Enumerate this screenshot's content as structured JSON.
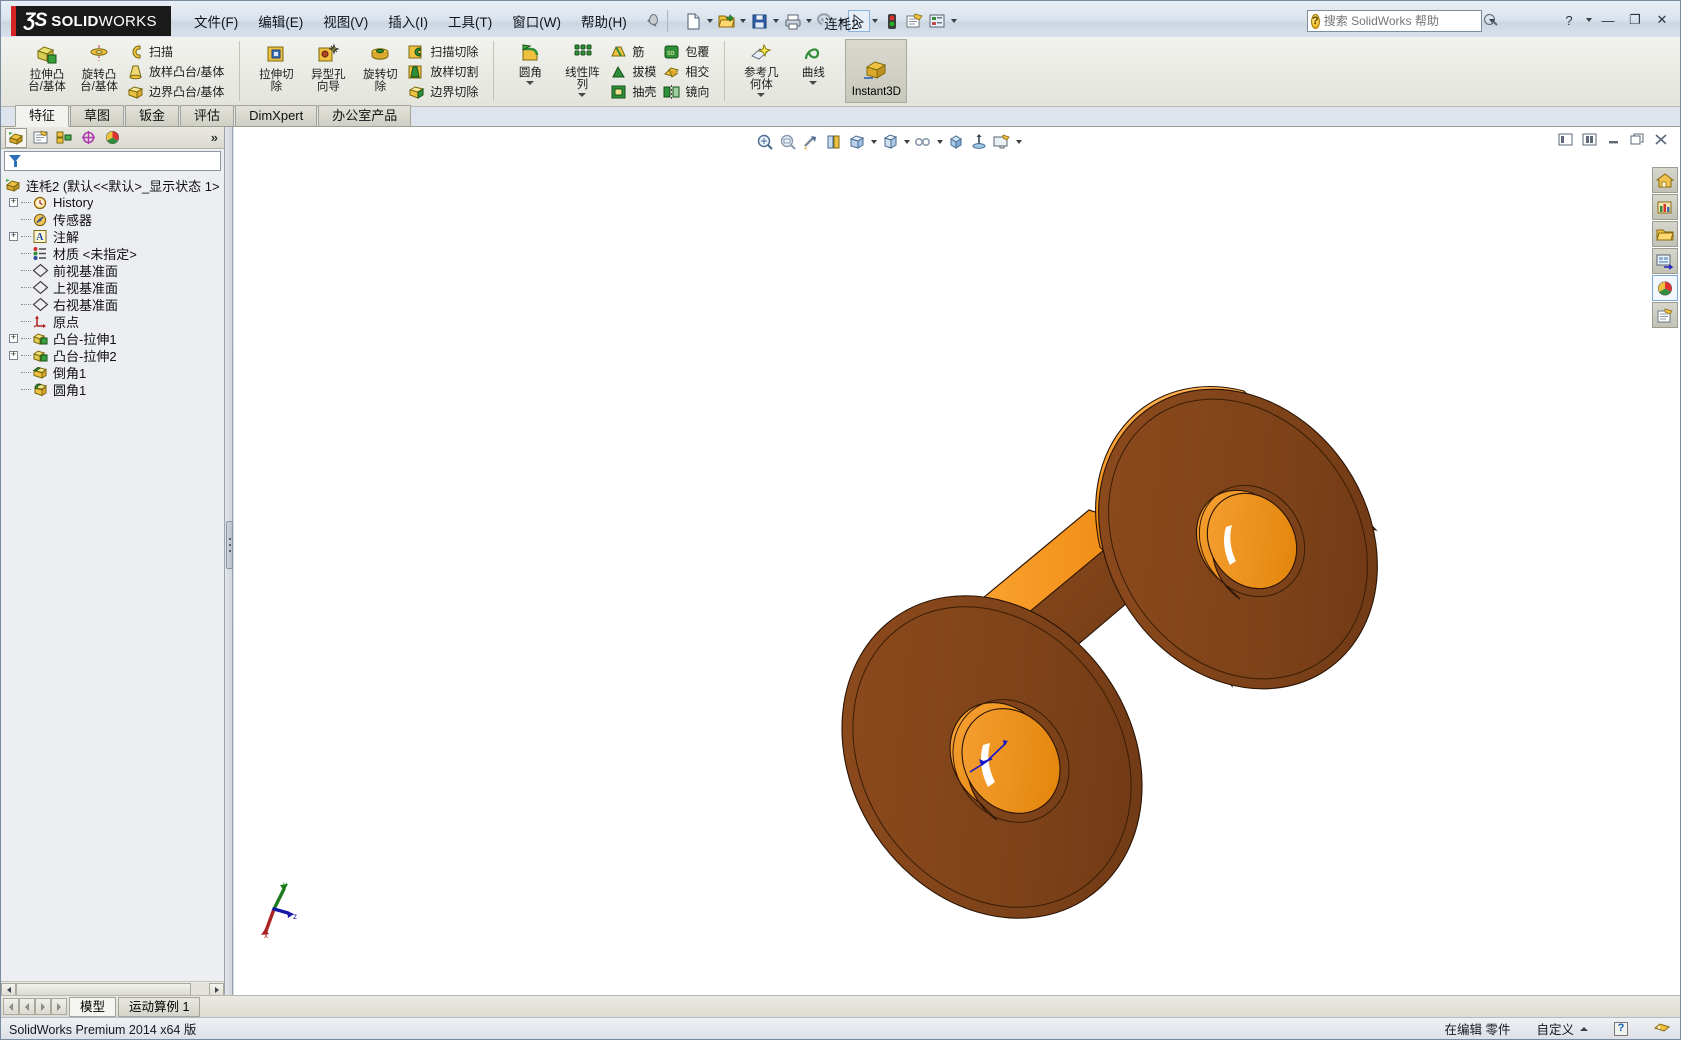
{
  "app": {
    "brand_ds": "ƷS",
    "brand_name_bold": "SOLID",
    "brand_name_thin": "WORKS",
    "document_title": "连枆2",
    "accent_red": "#d42424",
    "model_orange": "#f39019",
    "model_brown": "#8a4a1e"
  },
  "menubar": {
    "items": [
      {
        "label": "文件(F)",
        "name": "menu-file"
      },
      {
        "label": "编辑(E)",
        "name": "menu-edit"
      },
      {
        "label": "视图(V)",
        "name": "menu-view"
      },
      {
        "label": "插入(I)",
        "name": "menu-insert"
      },
      {
        "label": "工具(T)",
        "name": "menu-tools"
      },
      {
        "label": "窗口(W)",
        "name": "menu-window"
      },
      {
        "label": "帮助(H)",
        "name": "menu-help"
      }
    ]
  },
  "quick_toolbar": {
    "buttons": [
      {
        "name": "new-document-icon",
        "glyph": "new"
      },
      {
        "name": "open-document-icon",
        "glyph": "open"
      },
      {
        "name": "save-icon",
        "glyph": "save"
      },
      {
        "name": "print-icon",
        "glyph": "print"
      },
      {
        "name": "undo-icon",
        "glyph": "undo"
      },
      {
        "name": "select-arrow-icon",
        "glyph": "select"
      },
      {
        "name": "rebuild-traffic-light-icon",
        "glyph": "rebuild"
      },
      {
        "name": "options-icon",
        "glyph": "options"
      },
      {
        "name": "properties-icon",
        "glyph": "props"
      }
    ]
  },
  "search": {
    "placeholder": "搜索 SolidWorks 帮助",
    "value": ""
  },
  "window_buttons": {
    "help": "?",
    "minimize": "—",
    "restore": "❐",
    "close": "✕"
  },
  "ribbon": {
    "groups": [
      {
        "name": "features-boss",
        "big": [
          {
            "label": "拉伸凸\n台/基体",
            "name": "extruded-boss-base-button",
            "icon": "extrude-boss-icon"
          },
          {
            "label": "旋转凸\n台/基体",
            "name": "revolved-boss-base-button",
            "icon": "revolve-boss-icon"
          }
        ],
        "small": [
          {
            "label": "扫描",
            "name": "swept-boss-button",
            "icon": "sweep-icon"
          },
          {
            "label": "放样凸台/基体",
            "name": "lofted-boss-button",
            "icon": "loft-icon"
          },
          {
            "label": "边界凸台/基体",
            "name": "boundary-boss-button",
            "icon": "boundary-icon"
          }
        ]
      },
      {
        "name": "features-cut",
        "big": [
          {
            "label": "拉伸切\n除",
            "name": "extruded-cut-button",
            "icon": "extrude-cut-icon"
          },
          {
            "label": "异型孔\n向导",
            "name": "hole-wizard-button",
            "icon": "hole-wizard-icon"
          },
          {
            "label": "旋转切\n除",
            "name": "revolved-cut-button",
            "icon": "revolve-cut-icon"
          }
        ],
        "small": [
          {
            "label": "扫描切除",
            "name": "swept-cut-button",
            "icon": "sweep-cut-icon"
          },
          {
            "label": "放样切割",
            "name": "lofted-cut-button",
            "icon": "loft-cut-icon"
          },
          {
            "label": "边界切除",
            "name": "boundary-cut-button",
            "icon": "boundary-cut-icon"
          }
        ]
      },
      {
        "name": "features-modify",
        "big": [
          {
            "label": "圆角",
            "name": "fillet-button",
            "icon": "fillet-icon",
            "dropdown": true
          },
          {
            "label": "线性阵\n列",
            "name": "linear-pattern-button",
            "icon": "linear-pattern-icon",
            "dropdown": true
          }
        ],
        "small": [
          {
            "label": "筋",
            "name": "rib-button",
            "icon": "rib-icon"
          },
          {
            "label": "拔模",
            "name": "draft-button",
            "icon": "draft-icon"
          },
          {
            "label": "抽壳",
            "name": "shell-button",
            "icon": "shell-icon"
          }
        ],
        "small2": [
          {
            "label": "包覆",
            "name": "wrap-button",
            "icon": "wrap-icon"
          },
          {
            "label": "相交",
            "name": "intersect-button",
            "icon": "intersect-icon"
          },
          {
            "label": "镜向",
            "name": "mirror-button",
            "icon": "mirror-icon"
          }
        ]
      },
      {
        "name": "features-reference",
        "big": [
          {
            "label": "参考几\n何体",
            "name": "reference-geometry-button",
            "icon": "reference-geometry-icon",
            "dropdown": true
          },
          {
            "label": "曲线",
            "name": "curves-button",
            "icon": "curve-icon",
            "dropdown": true
          }
        ]
      }
    ],
    "instant3d": {
      "label": "Instant3D",
      "name": "instant3d-button"
    }
  },
  "command_tabs": [
    {
      "label": "特征",
      "name": "tab-features",
      "active": true
    },
    {
      "label": "草图",
      "name": "tab-sketch",
      "active": false
    },
    {
      "label": "钣金",
      "name": "tab-sheetmetal",
      "active": false
    },
    {
      "label": "评估",
      "name": "tab-evaluate",
      "active": false
    },
    {
      "label": "DimXpert",
      "name": "tab-dimxpert",
      "active": false
    },
    {
      "label": "办公室产品",
      "name": "tab-office-products",
      "active": false
    }
  ],
  "left_panel": {
    "tabs": [
      {
        "name": "feature-manager-tab",
        "icon": "feature-tree-icon",
        "active": true
      },
      {
        "name": "property-manager-tab",
        "icon": "property-manager-icon",
        "active": false
      },
      {
        "name": "configuration-manager-tab",
        "icon": "configuration-icon",
        "active": false
      },
      {
        "name": "dimxpert-manager-tab",
        "icon": "dimxpert-icon",
        "active": false
      },
      {
        "name": "display-manager-tab",
        "icon": "display-manager-icon",
        "active": false
      }
    ],
    "more_label": "»",
    "filter_placeholder": "",
    "tree": [
      {
        "label": "连枆2  (默认<<默认>_显示状态 1>",
        "name": "tree-item-part-root",
        "icon": "part-icon",
        "expand": "none",
        "indent": 0,
        "root": true
      },
      {
        "label": "History",
        "name": "tree-item-history",
        "icon": "history-icon",
        "expand": "plus",
        "indent": 1
      },
      {
        "label": "传感器",
        "name": "tree-item-sensors",
        "icon": "sensor-icon",
        "expand": "none",
        "indent": 1
      },
      {
        "label": "注解",
        "name": "tree-item-annotations",
        "icon": "annotations-icon",
        "expand": "plus",
        "indent": 1
      },
      {
        "label": "材质 <未指定>",
        "name": "tree-item-material",
        "icon": "material-icon",
        "expand": "none",
        "indent": 1
      },
      {
        "label": "前视基准面",
        "name": "tree-item-front-plane",
        "icon": "plane-icon",
        "expand": "none",
        "indent": 1
      },
      {
        "label": "上视基准面",
        "name": "tree-item-top-plane",
        "icon": "plane-icon",
        "expand": "none",
        "indent": 1
      },
      {
        "label": "右视基准面",
        "name": "tree-item-right-plane",
        "icon": "plane-icon",
        "expand": "none",
        "indent": 1
      },
      {
        "label": "原点",
        "name": "tree-item-origin",
        "icon": "origin-icon",
        "expand": "none",
        "indent": 1
      },
      {
        "label": "凸台-拉伸1",
        "name": "tree-item-boss-extrude1",
        "icon": "boss-extrude-icon",
        "expand": "plus",
        "indent": 1
      },
      {
        "label": "凸台-拉伸2",
        "name": "tree-item-boss-extrude2",
        "icon": "boss-extrude-icon",
        "expand": "plus",
        "indent": 1
      },
      {
        "label": "倒角1",
        "name": "tree-item-chamfer1",
        "icon": "chamfer-icon",
        "expand": "none",
        "indent": 1
      },
      {
        "label": "圆角1",
        "name": "tree-item-fillet1",
        "icon": "fillet-tree-icon",
        "expand": "none",
        "indent": 1
      }
    ]
  },
  "view_toolbar": [
    {
      "name": "zoom-to-fit-icon"
    },
    {
      "name": "zoom-to-area-icon"
    },
    {
      "name": "previous-view-icon"
    },
    {
      "name": "section-view-icon"
    },
    {
      "name": "view-orientation-icon",
      "dropdown": true
    },
    {
      "name": "display-style-icon",
      "dropdown": true
    },
    {
      "name": "hide-show-items-icon",
      "dropdown": true
    },
    {
      "name": "edit-appearance-icon"
    },
    {
      "name": "apply-scene-icon"
    },
    {
      "name": "view-settings-icon",
      "dropdown": true
    }
  ],
  "graphics_window_buttons": [
    {
      "name": "viewport-single-button"
    },
    {
      "name": "viewport-split-button"
    },
    {
      "name": "window-minimize-button"
    },
    {
      "name": "window-restore-button"
    },
    {
      "name": "window-close-button"
    }
  ],
  "right_dock": [
    {
      "name": "design-library-home-icon"
    },
    {
      "name": "design-library-icon"
    },
    {
      "name": "file-explorer-icon"
    },
    {
      "name": "view-palette-icon"
    },
    {
      "name": "appearances-scenes-icon",
      "selected": true
    },
    {
      "name": "custom-properties-icon"
    }
  ],
  "triad": {
    "x_label": "x",
    "y_label": "y",
    "z_label": "z",
    "x_color": "#aa2222",
    "y_color": "#1d7a1d",
    "z_color": "#2222aa"
  },
  "bottom_tabs": [
    {
      "label": "模型",
      "name": "bottom-tab-model",
      "active": true
    },
    {
      "label": "运动算例 1",
      "name": "bottom-tab-motion-study",
      "active": false
    }
  ],
  "statusbar": {
    "left": "SolidWorks Premium 2014 x64 版",
    "edit_state": "在编辑 零件",
    "custom": "自定义",
    "help_glyph": "?"
  }
}
